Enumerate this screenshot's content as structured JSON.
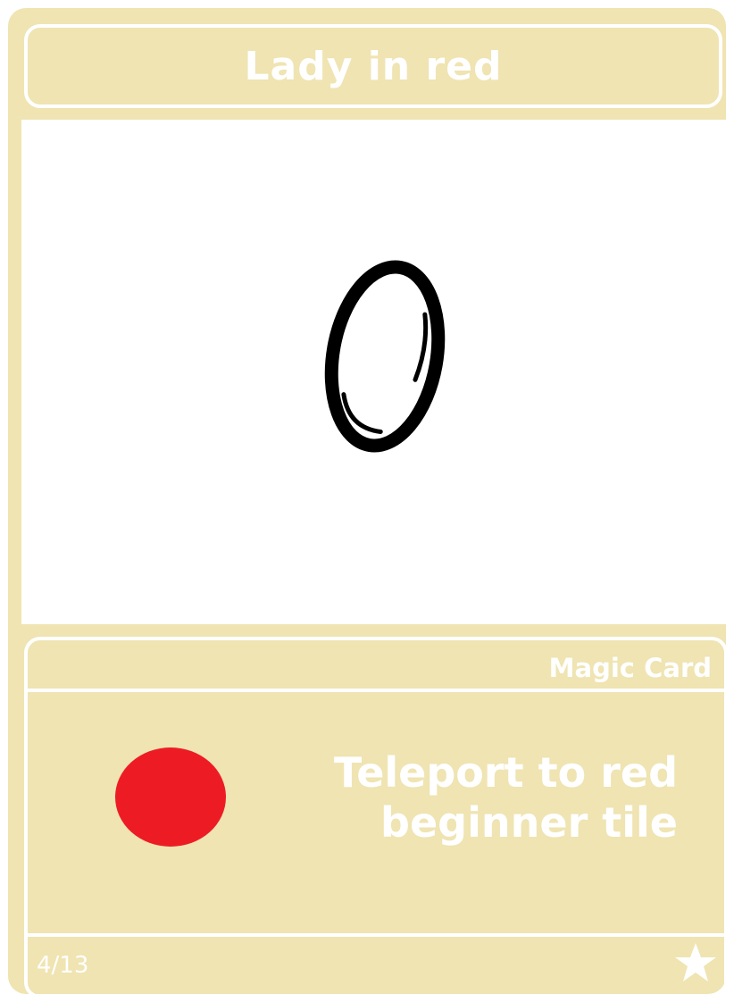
{
  "card": {
    "title": "Lady in red",
    "type_label": "Magic Card",
    "effect_text_line1": "Teleport to red",
    "effect_text_line2": "beginner tile",
    "counter": "4/13",
    "colors": {
      "card_background": "#EFE4B2",
      "border": "#ffffff",
      "effect_dot": "#ED1C24",
      "art_background": "#ffffff",
      "ring": "#000000"
    },
    "icons": {
      "art": "ring-icon",
      "effect": "red-dot-icon",
      "rarity": "star-icon"
    }
  }
}
